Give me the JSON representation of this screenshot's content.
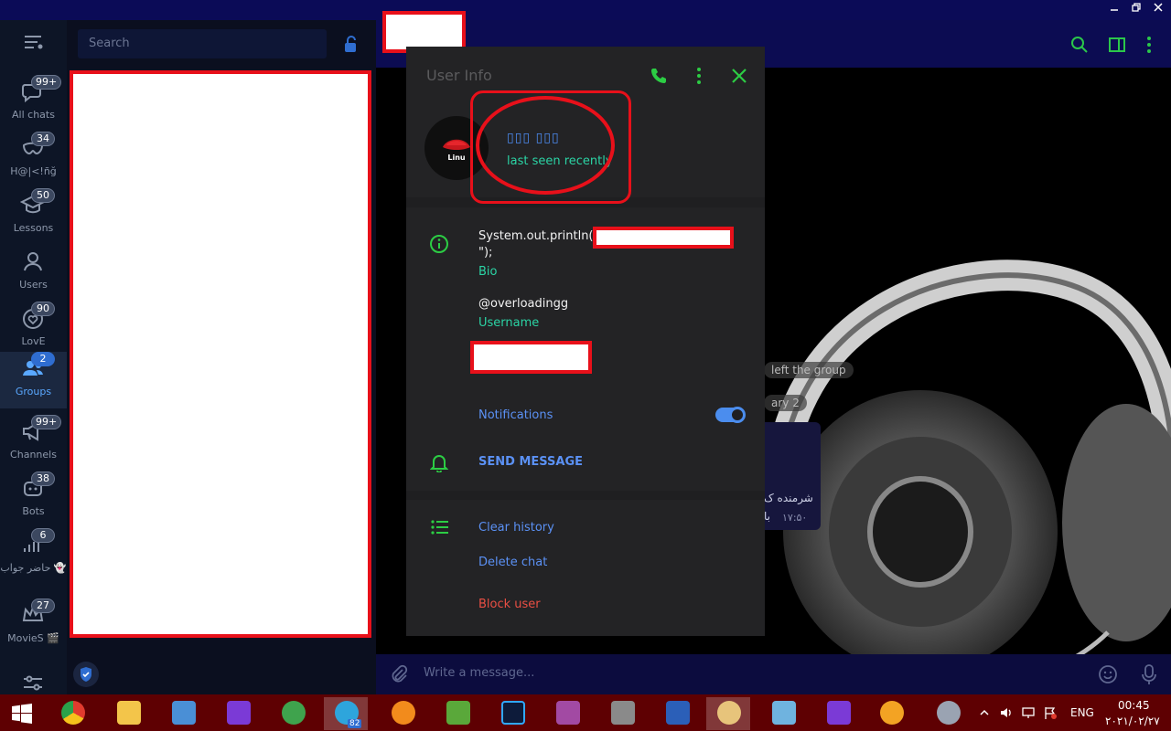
{
  "search": {
    "placeholder": "Search"
  },
  "folders": [
    {
      "label": "All chats",
      "badge": "99+",
      "icon": "chats-icon"
    },
    {
      "label": "H@|<!ñğ",
      "badge": "34",
      "icon": "mask-icon"
    },
    {
      "label": "Lessons",
      "badge": "50",
      "icon": "graduation-cap-icon"
    },
    {
      "label": "Users",
      "badge": "",
      "icon": "user-icon"
    },
    {
      "label": "LovE",
      "badge": "90",
      "icon": "heart-icon"
    },
    {
      "label": "Groups",
      "badge": "2",
      "icon": "group-icon"
    },
    {
      "label": "Channels",
      "badge": "99+",
      "icon": "megaphone-icon"
    },
    {
      "label": "Bots",
      "badge": "38",
      "icon": "robot-icon"
    },
    {
      "label": "حاضر جواب 👻",
      "badge": "6",
      "icon": "chart-icon"
    },
    {
      "label": "MovieS 🎬",
      "badge": "27",
      "icon": "crown-icon"
    }
  ],
  "user_info": {
    "title": "User Info",
    "name": "▯▯▯ ▯▯▯",
    "status": "last seen recently",
    "bio_line1": "System.out.println(\"",
    "bio_line2": "\");",
    "bio_label": "Bio",
    "username": "@overloadingg",
    "username_label": "Username",
    "notifications_label": "Notifications",
    "notifications_on": true,
    "send_message": "SEND MESSAGE",
    "clear_history": "Clear history",
    "delete_chat": "Delete chat",
    "block_user": "Block user"
  },
  "chat": {
    "input_placeholder": "Write a message...",
    "bg_msg1": "left the group",
    "bg_msg2": "ary 2",
    "bg_msg3": "شرمنده ک",
    "bg_msg4": "با",
    "bg_time": "۱۷:۵۰"
  },
  "taskbar": {
    "lang": "ENG",
    "time": "00:45",
    "date": "۲۰۲۱/۰۲/۲۷",
    "telegram_badge": "82"
  },
  "colors": {
    "accent_green": "#2ccd44",
    "accent_blue": "#5b91f5",
    "danger": "#ea4f44",
    "redaction": "#e8101a"
  }
}
